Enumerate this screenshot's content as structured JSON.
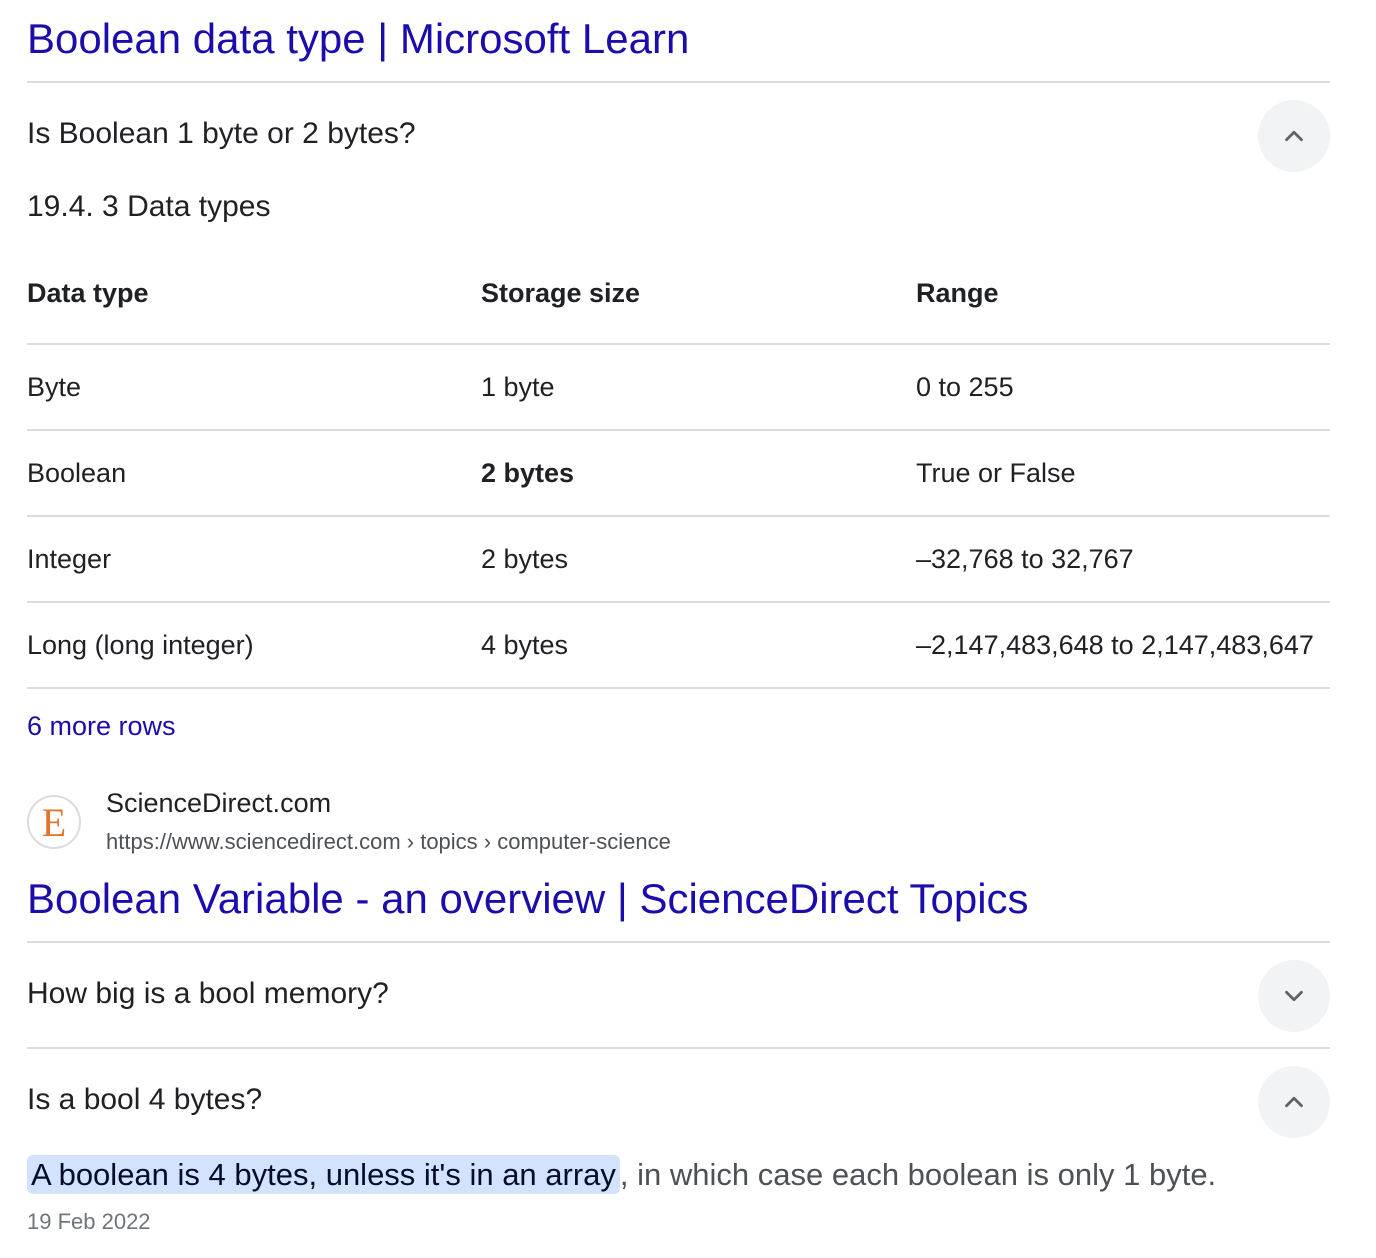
{
  "result1": {
    "title": "Boolean data type | Microsoft Learn",
    "faq": {
      "question": "Is Boolean 1 byte or 2 bytes?",
      "subheading": "19.4. 3 Data types",
      "table": {
        "headers": [
          "Data type",
          "Storage size",
          "Range"
        ],
        "rows": [
          [
            "Byte",
            "1 byte",
            "0 to 255"
          ],
          [
            "Boolean",
            "2 bytes",
            "True or False"
          ],
          [
            "Integer",
            "2 bytes",
            "–32,768 to 32,767"
          ],
          [
            "Long (long integer)",
            "4 bytes",
            "–2,147,483,648 to 2,147,483,647"
          ]
        ]
      },
      "more_rows": "6 more rows"
    }
  },
  "result2": {
    "favicon_letter": "E",
    "favicon_color": "#e4732b",
    "site_name": "ScienceDirect.com",
    "url": "https://www.sciencedirect.com › topics › computer-science",
    "title": "Boolean Variable - an overview | ScienceDirect Topics",
    "faq": [
      {
        "question": "How big is a bool memory?",
        "state": "collapsed",
        "icon": "chevron-down-icon"
      },
      {
        "question": "Is a bool 4 bytes?",
        "state": "expanded",
        "icon": "chevron-up-icon",
        "answer_highlight": "A boolean is 4 bytes, unless it's in an array",
        "answer_rest": ", in which case each boolean is only 1 byte.",
        "date": "19 Feb 2022"
      }
    ]
  },
  "colors": {
    "link": "#1a0dab",
    "divider": "#dadce0",
    "highlight": "#d3e3fd",
    "button_bg": "#f1f3f4"
  }
}
